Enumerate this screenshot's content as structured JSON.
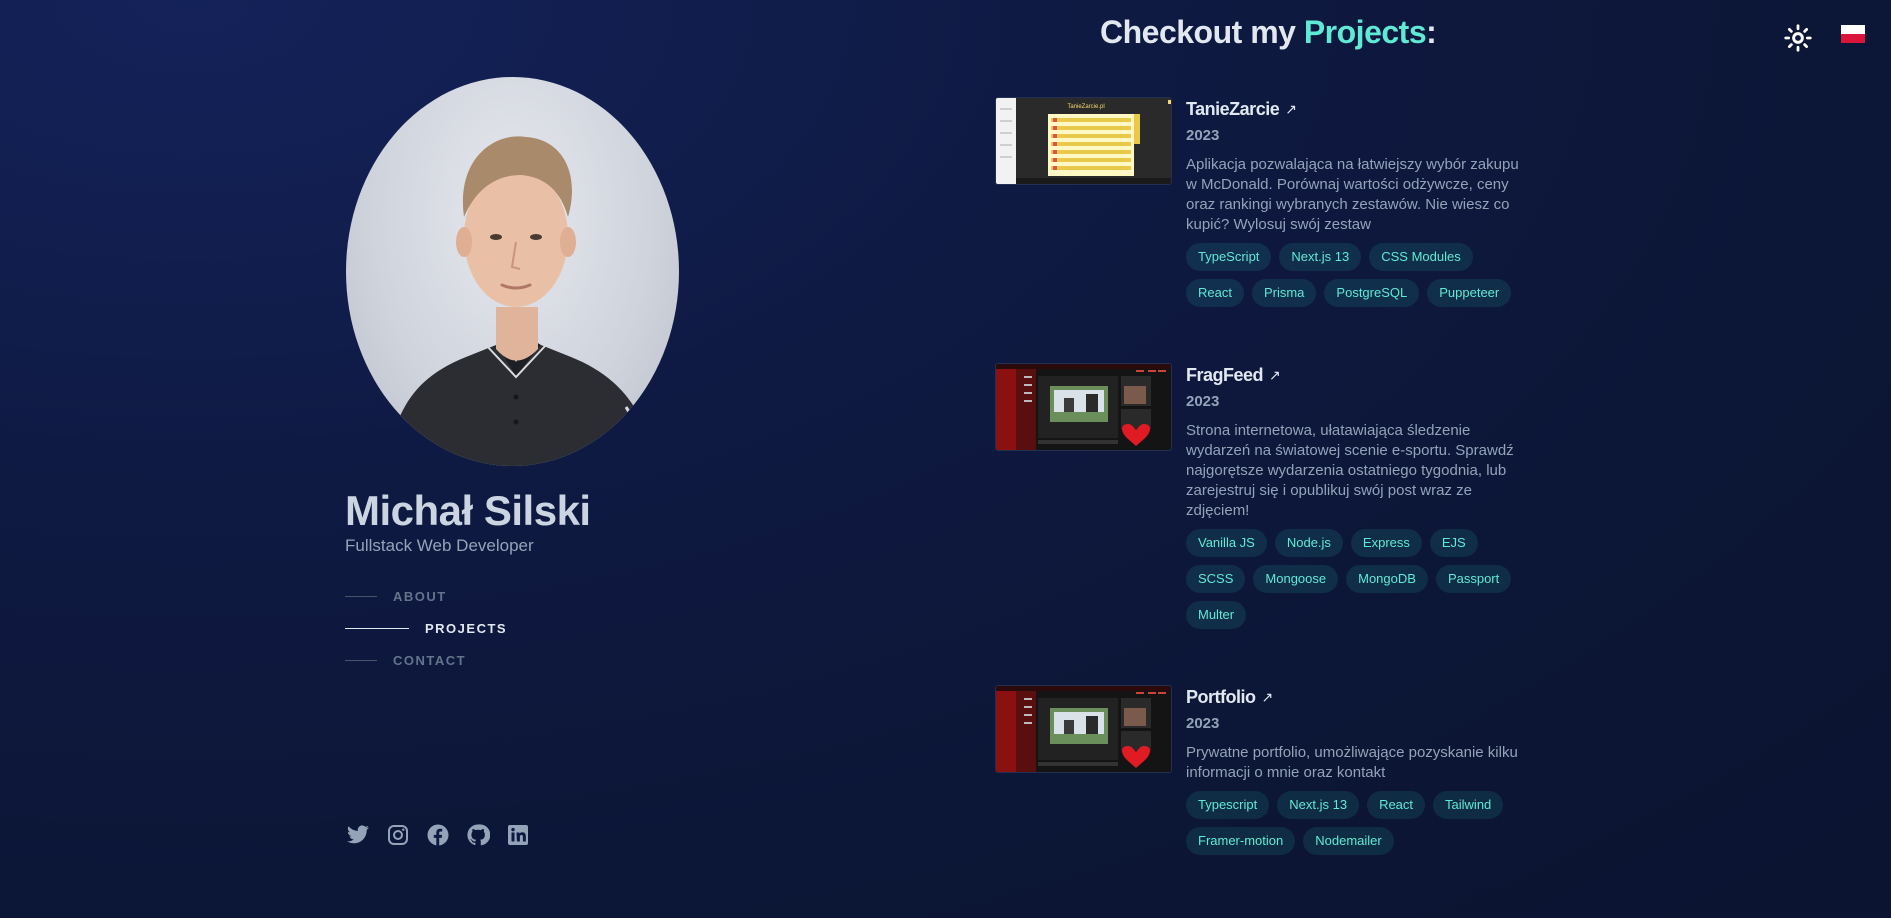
{
  "header": {
    "title_prefix": "Checkout my ",
    "title_accent": "Projects",
    "title_suffix": ":",
    "theme_toggle_icon": "sun-icon",
    "language_icon": "poland-flag-icon"
  },
  "profile": {
    "name": "Michał Silski",
    "role": "Fullstack Web Developer"
  },
  "nav": {
    "items": [
      {
        "label": "ABOUT",
        "active": false
      },
      {
        "label": "PROJECTS",
        "active": true
      },
      {
        "label": "CONTACT",
        "active": false
      }
    ]
  },
  "socials": [
    "twitter-icon",
    "instagram-icon",
    "facebook-icon",
    "github-icon",
    "linkedin-icon"
  ],
  "projects": [
    {
      "title": "TanieZarcie",
      "year": "2023",
      "description": "Aplikacja pozwalająca na łatwiejszy wybór zakupu w McDonald. Porównaj wartości odżywcze, ceny oraz rankingi wybranych zestawów. Nie wiesz co kupić? Wylosuj swój zestaw",
      "thumb_title": "TanieZarcie.pl",
      "tags": [
        "TypeScript",
        "Next.js 13",
        "CSS Modules",
        "React",
        "Prisma",
        "PostgreSQL",
        "Puppeteer"
      ]
    },
    {
      "title": "FragFeed",
      "year": "2023",
      "description": "Strona internetowa, ułatawiająca śledzenie wydarzeń na światowej scenie e-sportu. Sprawdź najgorętsze wydarzenia ostatniego tygodnia, lub zarejestruj się i opublikuj swój post wraz ze zdjęciem!",
      "tags": [
        "Vanilla JS",
        "Node.js",
        "Express",
        "EJS",
        "SCSS",
        "Mongoose",
        "MongoDB",
        "Passport",
        "Multer"
      ]
    },
    {
      "title": "Portfolio",
      "year": "2023",
      "description": "Prywatne portfolio, umożliwające pozyskanie kilku informacji o mnie oraz kontakt",
      "tags": [
        "Typescript",
        "Next.js 13",
        "React",
        "Tailwind",
        "Framer-motion",
        "Nodemailer"
      ]
    }
  ],
  "colors": {
    "accent": "#5eead4",
    "background": "#0f1a44",
    "text": "#94a3b8",
    "heading": "#e2e8f0"
  }
}
